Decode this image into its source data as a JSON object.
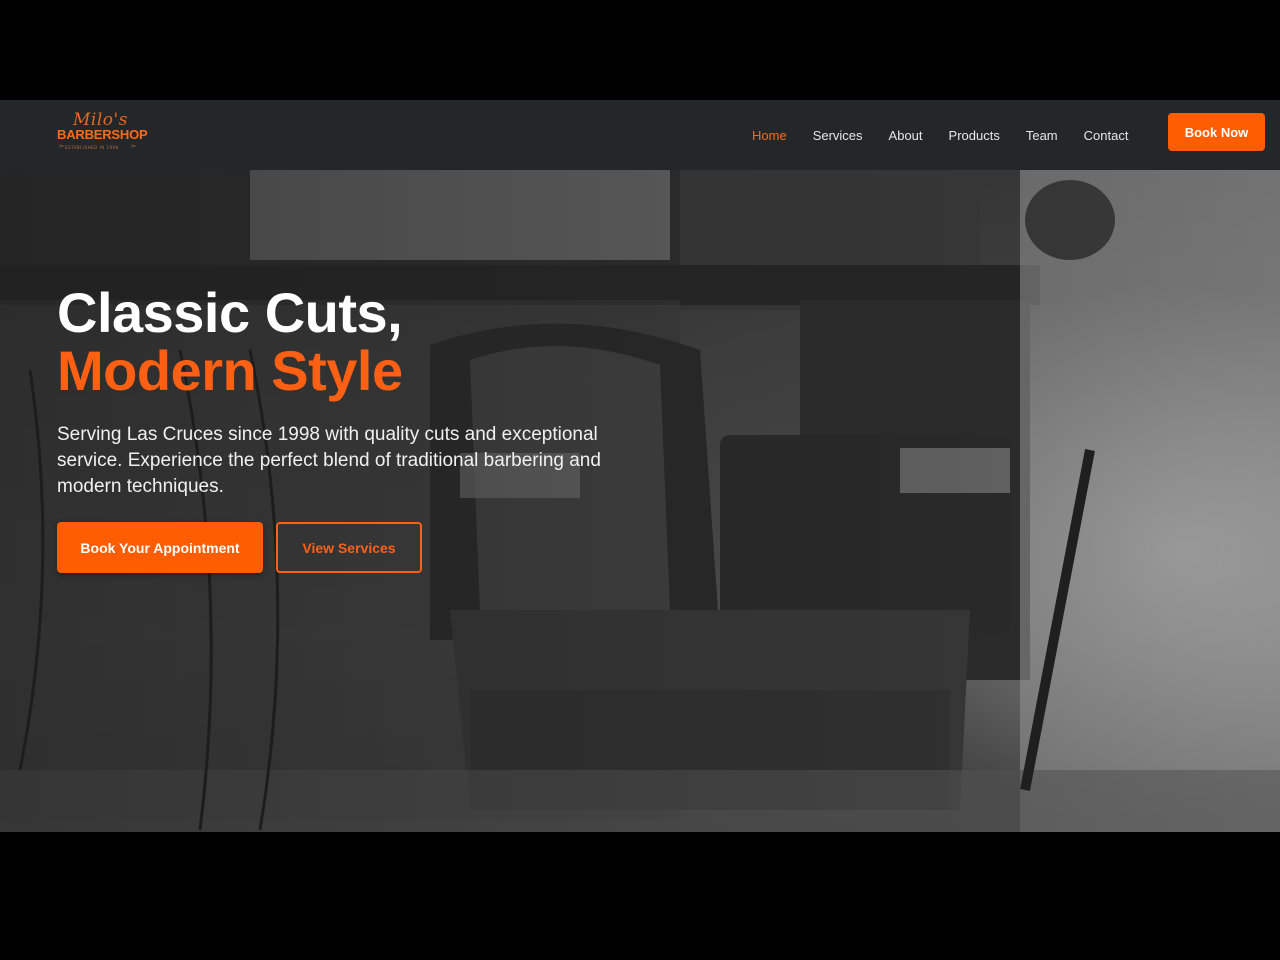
{
  "logo": {
    "script_text": "Milo's",
    "word_text": "BARBERSHOP",
    "tagline": "ESTABLISHED IN 1998"
  },
  "nav": {
    "items": [
      {
        "label": "Home",
        "active": true
      },
      {
        "label": "Services",
        "active": false
      },
      {
        "label": "About",
        "active": false
      },
      {
        "label": "Products",
        "active": false
      },
      {
        "label": "Team",
        "active": false
      },
      {
        "label": "Contact",
        "active": false
      }
    ],
    "cta_label": "Book Now"
  },
  "hero": {
    "heading_line1": "Classic Cuts,",
    "heading_line2": "Modern Style",
    "subtitle": "Serving Las Cruces since 1998 with quality cuts and exceptional service. Experience the perfect blend of traditional barbering and modern techniques.",
    "primary_button": "Book Your Appointment",
    "secondary_button": "View Services",
    "background_image": "barber-chair-photo"
  },
  "colors": {
    "accent": "#ff5d00",
    "navbar_bg": "#24272a",
    "heading_white": "#ffffff",
    "heading_accent": "#ff6014"
  }
}
